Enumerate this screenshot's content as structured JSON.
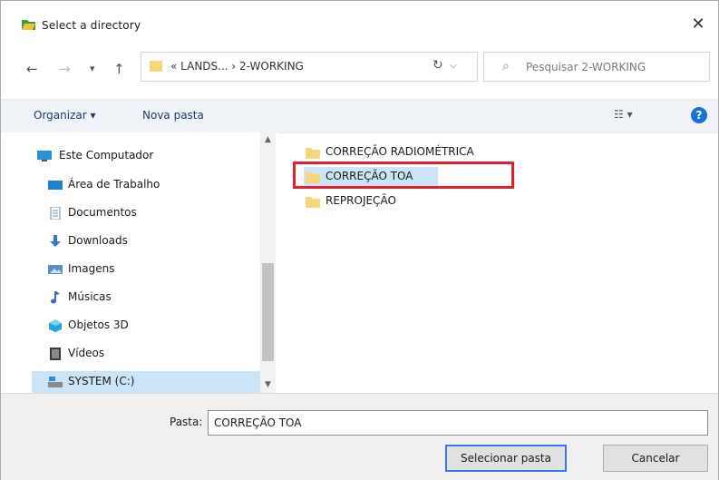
{
  "window": {
    "title": "Select a directory",
    "close_glyph": "✕"
  },
  "nav": {
    "back": "←",
    "forward": "→",
    "recent": "▾",
    "up": "↑"
  },
  "address": {
    "crumbs": "« LANDS... › 2-WORKING",
    "dropdown": "⌵"
  },
  "refresh_glyph": "↻",
  "search": {
    "placeholder": "Pesquisar 2-WORKING",
    "icon": "⌕"
  },
  "toolbar": {
    "organize": "Organizar ▾",
    "new_folder": "Nova pasta",
    "view": "☷ ▾",
    "help": "?"
  },
  "sidebar": {
    "items": [
      {
        "label": "Este Computador",
        "icon": "computer-icon"
      },
      {
        "label": "Área de Trabalho",
        "icon": "desktop-icon"
      },
      {
        "label": "Documentos",
        "icon": "documents-icon"
      },
      {
        "label": "Downloads",
        "icon": "download-icon"
      },
      {
        "label": "Imagens",
        "icon": "pictures-icon"
      },
      {
        "label": "Músicas",
        "icon": "music-icon"
      },
      {
        "label": "Objetos 3D",
        "icon": "objects3d-icon"
      },
      {
        "label": "Vídeos",
        "icon": "videos-icon"
      },
      {
        "label": "SYSTEM (C:)",
        "icon": "drive-icon"
      }
    ],
    "scroll_up": "▲",
    "scroll_down": "▼"
  },
  "files": [
    {
      "name": "CORREÇÃO RADIOMÉTRICA"
    },
    {
      "name": "CORREÇÃO TOA"
    },
    {
      "name": "REPROJEÇÃO"
    }
  ],
  "selection": {
    "selected_file": "CORREÇÃO TOA"
  },
  "footer": {
    "folder_label": "Pasta:",
    "folder_value": "CORREÇÃO TOA",
    "select_button": "Selecionar pasta",
    "cancel_button": "Cancelar"
  },
  "colors": {
    "folder": "#f6d77a",
    "selection": "#cce4f7",
    "highlight_box": "#e0202c",
    "accent": "#1e6fd9"
  }
}
